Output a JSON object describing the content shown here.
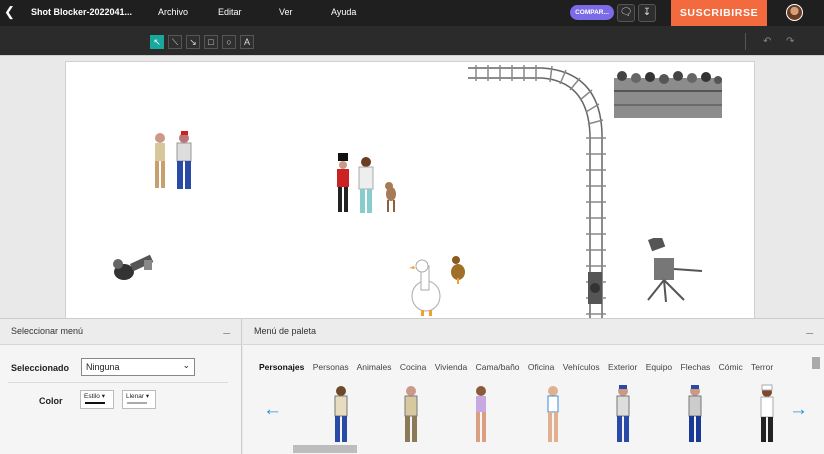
{
  "topbar": {
    "back_icon": "chevron-left-icon",
    "doc_title": "Shot Blocker-2022041...",
    "menus": [
      "Archivo",
      "Editar",
      "Ver",
      "Ayuda"
    ],
    "share_label": "COMPAR...",
    "subscribe_label": "SUSCRIBIRSE",
    "accent_color": "#f26a3d",
    "share_color": "#7b6be6"
  },
  "toolbar": {
    "tools": [
      "select-arrow",
      "line",
      "arrow-line",
      "square",
      "circle",
      "text"
    ],
    "active_tool": "select-arrow",
    "active_color": "#19a89e"
  },
  "select_panel": {
    "title": "Seleccionar menú",
    "selected_label": "Seleccionado",
    "selected_value": "Ninguna",
    "color_label": "Color",
    "style_label": "Estilo",
    "fill_label": "Llenar"
  },
  "palette_panel": {
    "title": "Menú de paleta",
    "tabs": [
      "Personajes",
      "Personas",
      "Animales",
      "Cocina",
      "Vivienda",
      "Cama/baño",
      "Oficina",
      "Vehículos",
      "Exterior",
      "Equipo",
      "Flechas",
      "Cómic",
      "Terror"
    ],
    "active_tab": "Personajes",
    "arrow_color": "#2c8fd8"
  }
}
